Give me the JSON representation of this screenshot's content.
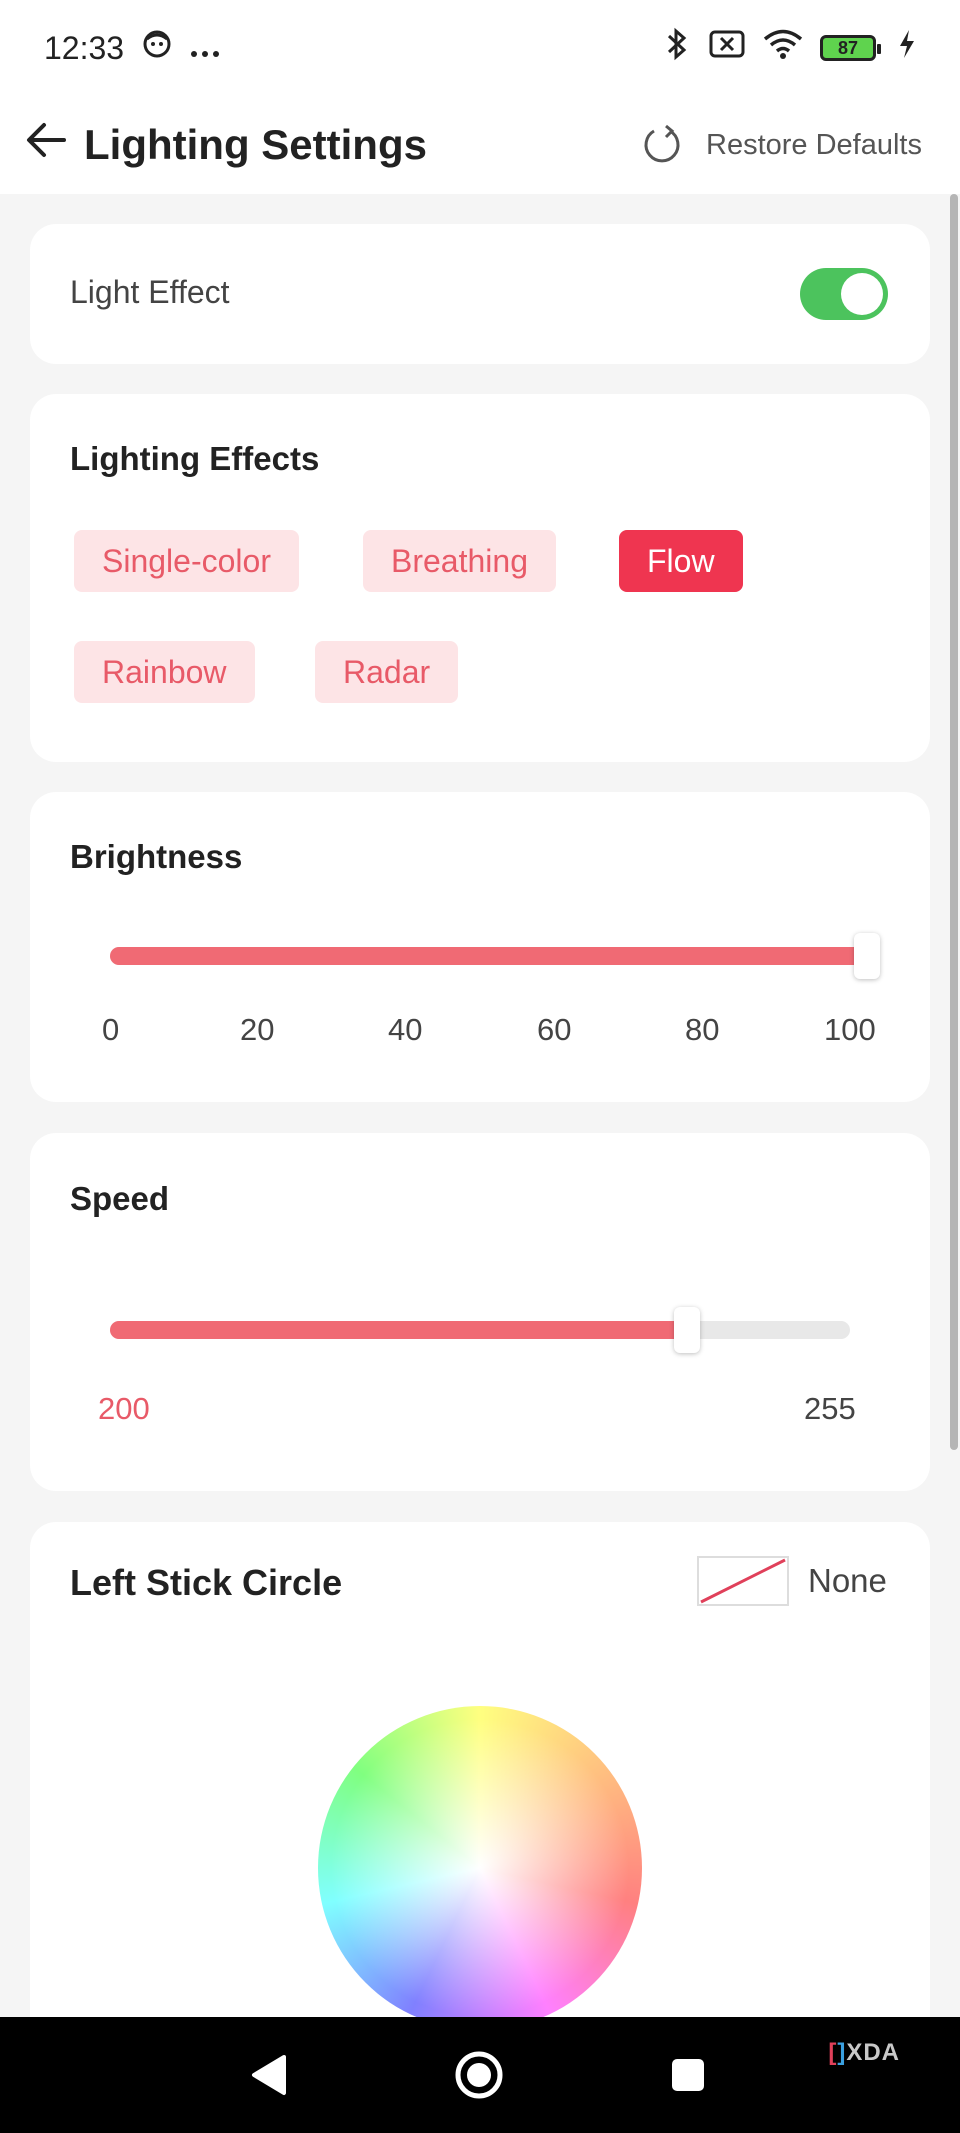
{
  "status_bar": {
    "time": "12:33",
    "battery_level": "87",
    "icons": [
      "face-icon",
      "more-dots-icon",
      "bluetooth-icon",
      "sim-off-icon",
      "wifi-icon",
      "battery-icon",
      "charging-icon"
    ]
  },
  "header": {
    "title": "Lighting Settings",
    "restore_label": "Restore Defaults",
    "back_icon": "arrow-left-icon",
    "restore_icon": "refresh-icon"
  },
  "light_effect": {
    "label": "Light Effect",
    "enabled": true,
    "toggle_color": "#4cc35d"
  },
  "lighting_effects": {
    "title": "Lighting Effects",
    "options": [
      "Single-color",
      "Breathing",
      "Flow",
      "Rainbow",
      "Radar"
    ],
    "selected": "Flow",
    "accent": "#ef3550"
  },
  "brightness": {
    "title": "Brightness",
    "value_fraction": 1.0,
    "ticks": [
      "0",
      "20",
      "40",
      "60",
      "80",
      "100"
    ]
  },
  "speed": {
    "title": "Speed",
    "value_fraction": 0.78,
    "min_label": "200",
    "max_label": "255"
  },
  "left_stick": {
    "title": "Left Stick Circle",
    "color_label": "None"
  },
  "branding": {
    "watermark": "XDA"
  }
}
